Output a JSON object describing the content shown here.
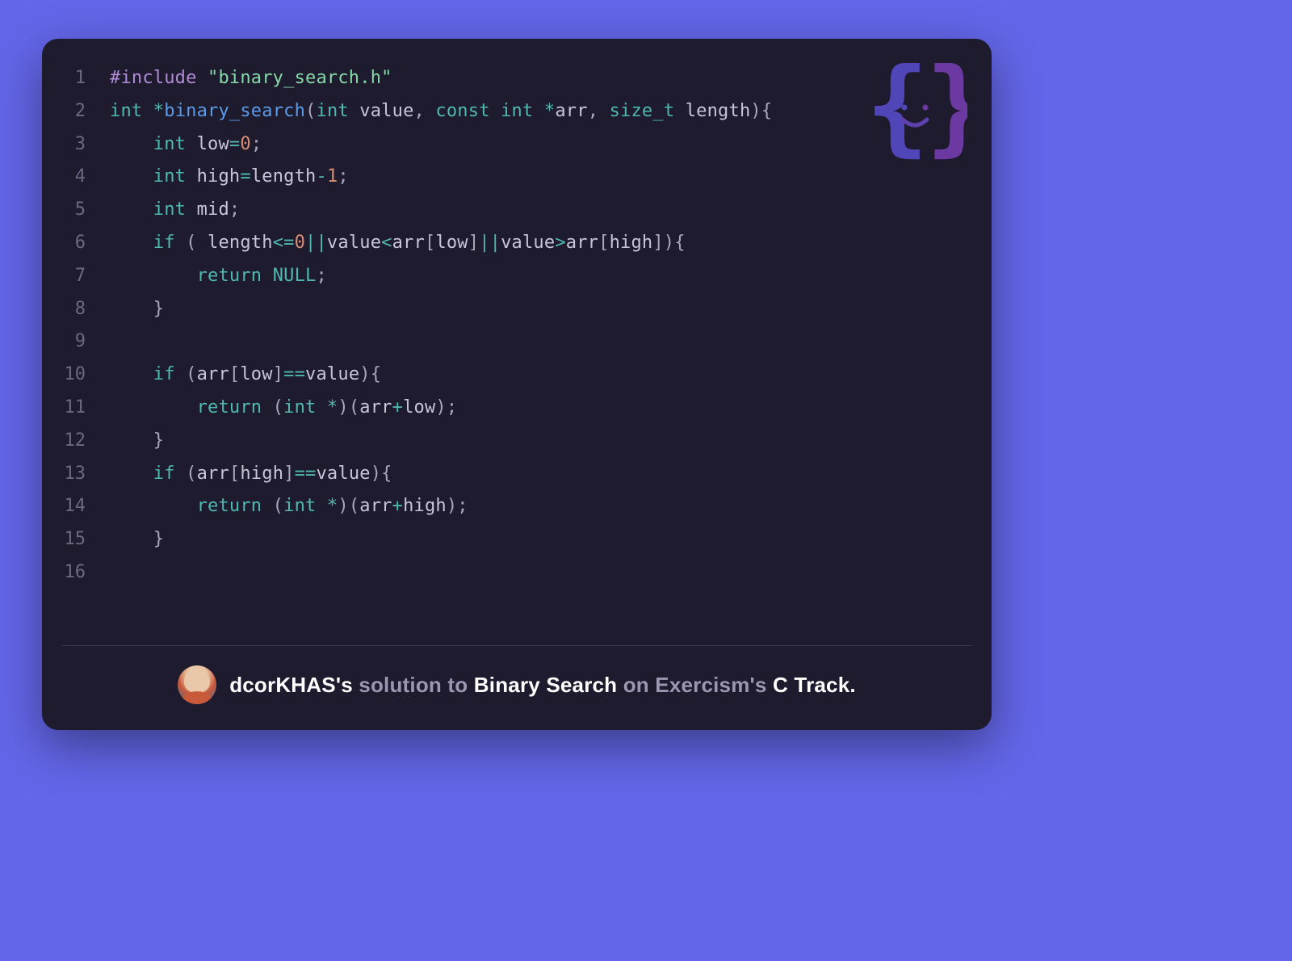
{
  "colors": {
    "page_bg": "#6366e8",
    "card_bg": "#1e1b2e",
    "gutter": "#6b6880",
    "text": "#c9c5d9",
    "divider": "#3a3654",
    "keyword": "#4fb8b0",
    "preproc": "#b18bd6",
    "string": "#86d9a9",
    "function": "#5a9ae6",
    "number": "#d98e73",
    "logo_left": "#5a4ed0",
    "logo_right": "#7a3fb8"
  },
  "logo_name": "exercism-logo",
  "code": {
    "language": "c",
    "line_count": 16,
    "lines": [
      {
        "n": 1,
        "tokens": [
          [
            "pre",
            "#include"
          ],
          [
            "punc",
            " "
          ],
          [
            "str",
            "\"binary_search.h\""
          ]
        ]
      },
      {
        "n": 2,
        "tokens": [
          [
            "type",
            "int"
          ],
          [
            "punc",
            " "
          ],
          [
            "op",
            "*"
          ],
          [
            "fn",
            "binary_search"
          ],
          [
            "punc",
            "("
          ],
          [
            "type",
            "int"
          ],
          [
            "punc",
            " "
          ],
          [
            "id",
            "value"
          ],
          [
            "punc",
            ", "
          ],
          [
            "kw",
            "const"
          ],
          [
            "punc",
            " "
          ],
          [
            "type",
            "int"
          ],
          [
            "punc",
            " "
          ],
          [
            "op",
            "*"
          ],
          [
            "id",
            "arr"
          ],
          [
            "punc",
            ", "
          ],
          [
            "type",
            "size_t"
          ],
          [
            "punc",
            " "
          ],
          [
            "id",
            "length"
          ],
          [
            "punc",
            "){"
          ]
        ]
      },
      {
        "n": 3,
        "tokens": [
          [
            "punc",
            "    "
          ],
          [
            "type",
            "int"
          ],
          [
            "punc",
            " "
          ],
          [
            "id",
            "low"
          ],
          [
            "op",
            "="
          ],
          [
            "num",
            "0"
          ],
          [
            "punc",
            ";"
          ]
        ]
      },
      {
        "n": 4,
        "tokens": [
          [
            "punc",
            "    "
          ],
          [
            "type",
            "int"
          ],
          [
            "punc",
            " "
          ],
          [
            "id",
            "high"
          ],
          [
            "op",
            "="
          ],
          [
            "id",
            "length"
          ],
          [
            "op",
            "-"
          ],
          [
            "num",
            "1"
          ],
          [
            "punc",
            ";"
          ]
        ]
      },
      {
        "n": 5,
        "tokens": [
          [
            "punc",
            "    "
          ],
          [
            "type",
            "int"
          ],
          [
            "punc",
            " "
          ],
          [
            "id",
            "mid"
          ],
          [
            "punc",
            ";"
          ]
        ]
      },
      {
        "n": 6,
        "tokens": [
          [
            "punc",
            "    "
          ],
          [
            "kw",
            "if"
          ],
          [
            "punc",
            " ( "
          ],
          [
            "id",
            "length"
          ],
          [
            "op",
            "<="
          ],
          [
            "num",
            "0"
          ],
          [
            "op",
            "||"
          ],
          [
            "id",
            "value"
          ],
          [
            "op",
            "<"
          ],
          [
            "id",
            "arr"
          ],
          [
            "punc",
            "["
          ],
          [
            "id",
            "low"
          ],
          [
            "punc",
            "]"
          ],
          [
            "op",
            "||"
          ],
          [
            "id",
            "value"
          ],
          [
            "op",
            ">"
          ],
          [
            "id",
            "arr"
          ],
          [
            "punc",
            "["
          ],
          [
            "id",
            "high"
          ],
          [
            "punc",
            "]){"
          ]
        ]
      },
      {
        "n": 7,
        "tokens": [
          [
            "punc",
            "        "
          ],
          [
            "kw",
            "return"
          ],
          [
            "punc",
            " "
          ],
          [
            "const",
            "NULL"
          ],
          [
            "punc",
            ";"
          ]
        ]
      },
      {
        "n": 8,
        "tokens": [
          [
            "punc",
            "    }"
          ]
        ]
      },
      {
        "n": 9,
        "tokens": []
      },
      {
        "n": 10,
        "tokens": [
          [
            "punc",
            "    "
          ],
          [
            "kw",
            "if"
          ],
          [
            "punc",
            " ("
          ],
          [
            "id",
            "arr"
          ],
          [
            "punc",
            "["
          ],
          [
            "id",
            "low"
          ],
          [
            "punc",
            "]"
          ],
          [
            "op",
            "=="
          ],
          [
            "id",
            "value"
          ],
          [
            "punc",
            "){"
          ]
        ]
      },
      {
        "n": 11,
        "tokens": [
          [
            "punc",
            "        "
          ],
          [
            "kw",
            "return"
          ],
          [
            "punc",
            " ("
          ],
          [
            "type",
            "int"
          ],
          [
            "punc",
            " "
          ],
          [
            "op",
            "*"
          ],
          [
            "punc",
            ")("
          ],
          [
            "id",
            "arr"
          ],
          [
            "op",
            "+"
          ],
          [
            "id",
            "low"
          ],
          [
            "punc",
            ");"
          ]
        ]
      },
      {
        "n": 12,
        "tokens": [
          [
            "punc",
            "    }"
          ]
        ]
      },
      {
        "n": 13,
        "tokens": [
          [
            "punc",
            "    "
          ],
          [
            "kw",
            "if"
          ],
          [
            "punc",
            " ("
          ],
          [
            "id",
            "arr"
          ],
          [
            "punc",
            "["
          ],
          [
            "id",
            "high"
          ],
          [
            "punc",
            "]"
          ],
          [
            "op",
            "=="
          ],
          [
            "id",
            "value"
          ],
          [
            "punc",
            "){"
          ]
        ]
      },
      {
        "n": 14,
        "tokens": [
          [
            "punc",
            "        "
          ],
          [
            "kw",
            "return"
          ],
          [
            "punc",
            " ("
          ],
          [
            "type",
            "int"
          ],
          [
            "punc",
            " "
          ],
          [
            "op",
            "*"
          ],
          [
            "punc",
            ")("
          ],
          [
            "id",
            "arr"
          ],
          [
            "op",
            "+"
          ],
          [
            "id",
            "high"
          ],
          [
            "punc",
            ");"
          ]
        ]
      },
      {
        "n": 15,
        "tokens": [
          [
            "punc",
            "    }"
          ]
        ]
      },
      {
        "n": 16,
        "tokens": []
      }
    ]
  },
  "footer": {
    "username": "dcorKHAS",
    "possessive": "'s",
    "solution_word": "solution to",
    "exercise": "Binary Search",
    "on_word": "on Exercism's",
    "track": "C Track",
    "period": "."
  }
}
